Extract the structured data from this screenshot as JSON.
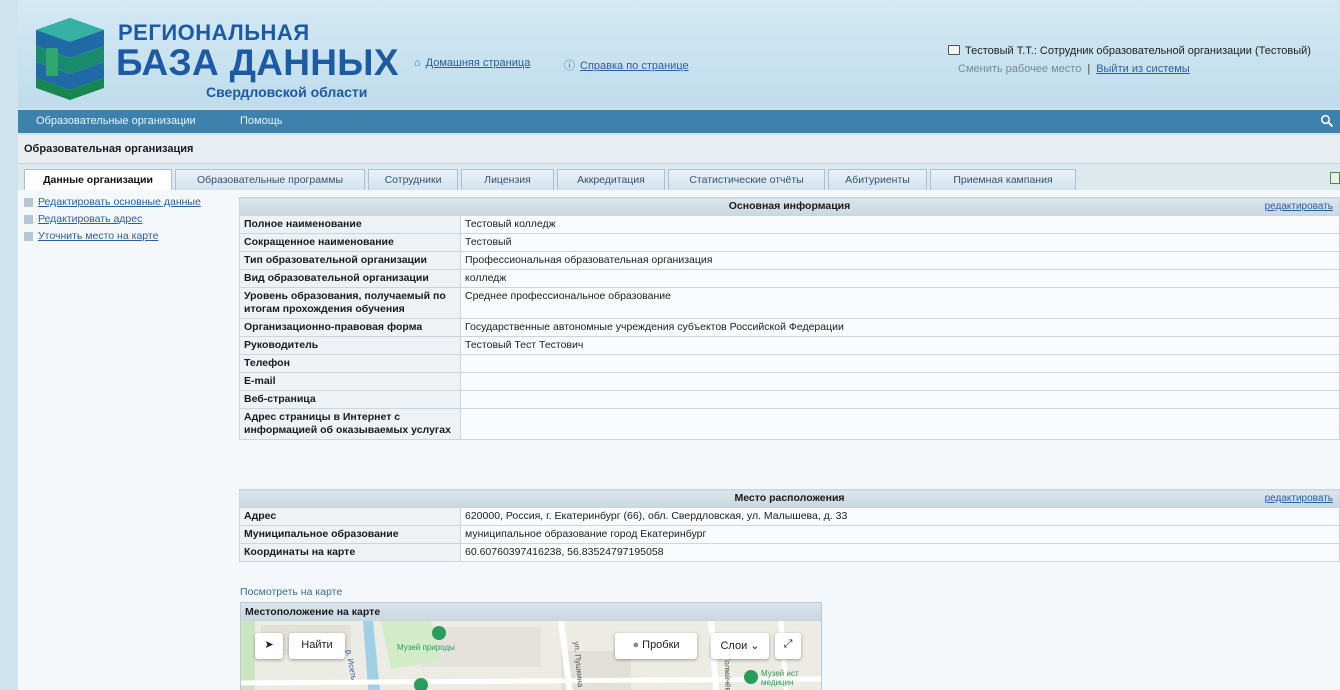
{
  "header": {
    "logo": {
      "line1": "РЕГИОНАЛЬНАЯ",
      "line2": "БАЗА ДАННЫХ",
      "line3": "Свердловской области"
    },
    "links": {
      "home": "Домашняя страница",
      "help": "Справка по странице"
    },
    "user": {
      "name": "Тестовый Т.Т.: Сотрудник образовательной организации (Тестовый)",
      "change_workplace": "Сменить рабочее место",
      "separator": "|",
      "logout": "Выйти из системы"
    }
  },
  "nav": {
    "items": [
      "Образовательные организации",
      "Помощь"
    ]
  },
  "page_title": "Образовательная организация",
  "tabs": [
    {
      "label": "Данные организации",
      "active": true
    },
    {
      "label": "Образовательные программы",
      "active": false
    },
    {
      "label": "Сотрудники",
      "active": false
    },
    {
      "label": "Лицензия",
      "active": false
    },
    {
      "label": "Аккредитация",
      "active": false
    },
    {
      "label": "Статистические отчёты",
      "active": false
    },
    {
      "label": "Абитуриенты",
      "active": false
    },
    {
      "label": "Приемная кампания",
      "active": false
    }
  ],
  "sidebar": {
    "items": [
      {
        "label": "Редактировать основные данные"
      },
      {
        "label": "Редактировать адрес"
      },
      {
        "label": "Уточнить место на карте"
      }
    ]
  },
  "basic_info": {
    "title": "Основная информация",
    "edit": "редактировать",
    "rows": [
      {
        "key": "Полное наименование",
        "value": "Тестовый колледж"
      },
      {
        "key": "Сокращенное наименование",
        "value": "Тестовый"
      },
      {
        "key": "Тип образовательной организации",
        "value": "Профессиональная образовательная организация"
      },
      {
        "key": "Вид образовательной организации",
        "value": "колледж"
      },
      {
        "key": "Уровень образования, получаемый по итогам прохождения обучения",
        "value": "Среднее профессиональное образование"
      },
      {
        "key": "Организационно-правовая форма",
        "value": "Государственные автономные учреждения субъектов Российской Федерации"
      },
      {
        "key": "Руководитель",
        "value": "Тестовый Тест Тестович"
      },
      {
        "key": "Телефон",
        "value": ""
      },
      {
        "key": "E-mail",
        "value": ""
      },
      {
        "key": "Веб-страница",
        "value": ""
      },
      {
        "key": "Адрес страницы в Интернет с информацией об оказываемых услугах",
        "value": ""
      }
    ]
  },
  "location": {
    "title": "Место расположения",
    "edit": "редактировать",
    "rows": [
      {
        "key": "Адрес",
        "value": "620000, Россия, г. Екатеринбург (66), обл. Свердловская, ул. Малышева, д. 33"
      },
      {
        "key": "Муниципальное образование",
        "value": "муниципальное образование город Екатеринбург"
      },
      {
        "key": "Координаты на карте",
        "value": "60.60760397416238, 56.83524797195058"
      }
    ]
  },
  "map": {
    "view_link": "Посмотреть на карте",
    "header": "Местоположение на карте",
    "find_label": "Найти",
    "traffic_label": "Пробки",
    "layers_label": "Слои",
    "poi_label": "Музей природы",
    "poi2_label": "Музей ист медицин",
    "street1": "ул. Пушкина",
    "street2": "ул. Толмачёва",
    "street3": "р. Исеть"
  }
}
